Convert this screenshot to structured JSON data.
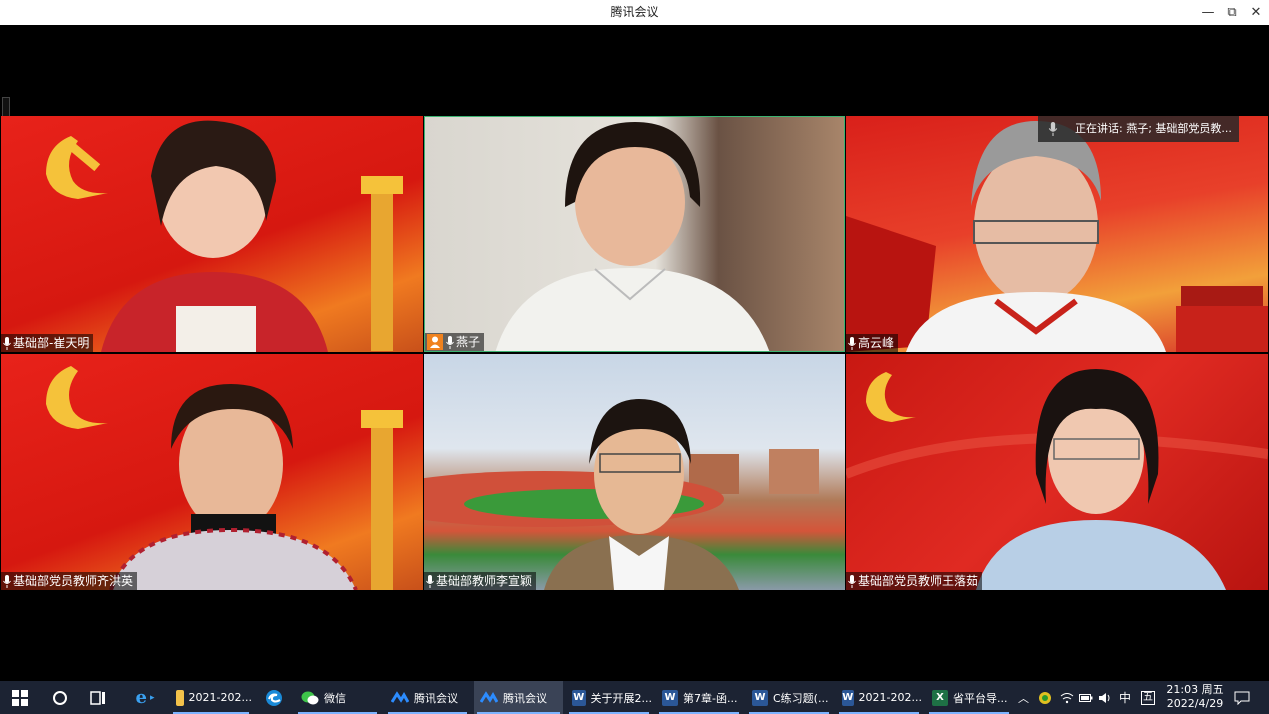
{
  "window": {
    "title": "腾讯会议",
    "minimize": "—",
    "restore": "⧉",
    "close": "✕"
  },
  "speaking_banner": "正在讲话: 燕子; 基础部党员教...",
  "participants": [
    {
      "name": "基础部-崔天明",
      "host": false
    },
    {
      "name": "燕子",
      "host": true
    },
    {
      "name": "高云峰",
      "host": false
    },
    {
      "name": "基础部党员教师齐洪英",
      "host": false
    },
    {
      "name": "基础部教师李宣颖",
      "host": false
    },
    {
      "name": "基础部党员教师王落茹",
      "host": false
    }
  ],
  "taskbar": {
    "items": [
      {
        "label": "2021-202...",
        "icon": "folder-icon"
      },
      {
        "label": "微信",
        "icon": "wechat-icon"
      },
      {
        "label": "腾讯会议",
        "icon": "tencent-meeting-icon"
      },
      {
        "label": "腾讯会议",
        "icon": "tencent-meeting-icon"
      },
      {
        "label": "关于开展2...",
        "icon": "word-icon"
      },
      {
        "label": "第7章-函...",
        "icon": "word-icon"
      },
      {
        "label": "C练习题(...",
        "icon": "word-icon"
      },
      {
        "label": "2021-202...",
        "icon": "word-icon"
      },
      {
        "label": "省平台导...",
        "icon": "excel-icon"
      }
    ],
    "tray": {
      "ime": "中",
      "ime2": "五",
      "time": "21:03 周五",
      "date": "2022/4/29"
    }
  },
  "colors": {
    "taskbar": "#1c2333",
    "red_bg": "#d8201a",
    "accent": "#f0821e"
  }
}
